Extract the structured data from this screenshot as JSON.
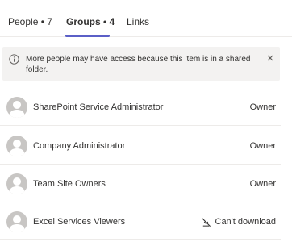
{
  "tabs": [
    {
      "label": "People • 7",
      "active": false
    },
    {
      "label": "Groups • 4",
      "active": true
    },
    {
      "label": "Links",
      "active": false
    }
  ],
  "banner": {
    "icon": "info-icon",
    "text": "More people may have access because this item is in a shared folder.",
    "close_icon": "close-icon"
  },
  "groups": [
    {
      "name": "SharePoint Service Administrator",
      "role": "Owner"
    },
    {
      "name": "Company Administrator",
      "role": "Owner"
    },
    {
      "name": "Team Site Owners",
      "role": "Owner"
    },
    {
      "name": "Excel Services Viewers",
      "role": "Can't download",
      "role_icon": "no-download-icon"
    }
  ],
  "colors": {
    "accent": "#5b5fc7",
    "banner_bg": "#f3f2f1",
    "avatar_bg": "#c8c6c4",
    "text": "#323130",
    "divider": "#edebe9"
  }
}
